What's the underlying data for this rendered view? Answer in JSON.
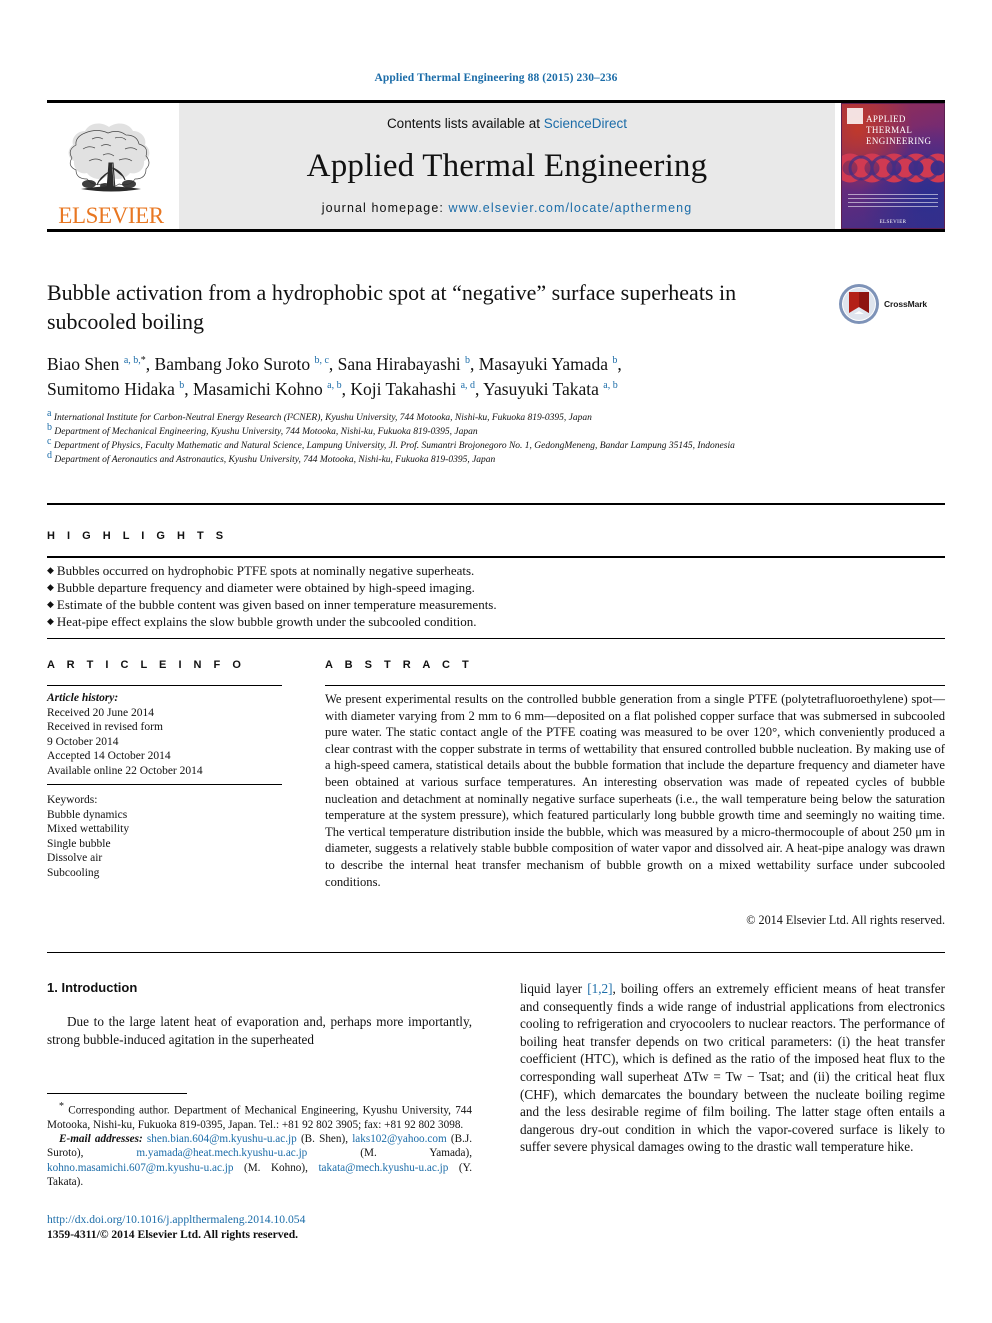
{
  "running_head": "Applied Thermal Engineering 88 (2015) 230–236",
  "masthead": {
    "contents_prefix": "Contents lists available at ",
    "sciencedirect": "ScienceDirect",
    "journal_title": "Applied Thermal Engineering",
    "homepage_prefix": "journal homepage: ",
    "homepage_url": "www.elsevier.com/locate/apthermeng",
    "publisher": "ELSEVIER",
    "cover": {
      "line1": "Applied",
      "line2": "Thermal",
      "line3": "Engineering",
      "footer": "ELSEVIER"
    },
    "colors": {
      "link": "#1b6ca8",
      "elsevier_orange": "#E87722",
      "masthead_bg": "#e9e9e9"
    }
  },
  "article": {
    "title": "Bubble activation from a hydrophobic spot at “negative” surface superheats in subcooled boiling",
    "crossmark_label": "CrossMark",
    "authors_line1": "Biao Shen a, b, *, Bambang Joko Suroto b, c, Sana Hirabayashi b, Masayuki Yamada b,",
    "authors_line2": "Sumitomo Hidaka b, Masamichi Kohno a, b, Koji Takahashi a, d, Yasuyuki Takata a, b",
    "affiliations": [
      "International Institute for Carbon-Neutral Energy Research (I²CNER), Kyushu University, 744 Motooka, Nishi-ku, Fukuoka 819-0395, Japan",
      "Department of Mechanical Engineering, Kyushu University, 744 Motooka, Nishi-ku, Fukuoka 819-0395, Japan",
      "Department of Physics, Faculty Mathematic and Natural Science, Lampung University, Jl. Prof. Sumantri Brojonegoro No. 1, GedongMeneng, Bandar Lampung 35145, Indonesia",
      "Department of Aeronautics and Astronautics, Kyushu University, 744 Motooka, Nishi-ku, Fukuoka 819-0395, Japan"
    ],
    "affiliation_marks": [
      "a",
      "b",
      "c",
      "d"
    ]
  },
  "highlights": {
    "heading": "H I G H L I G H T S",
    "items": [
      "Bubbles occurred on hydrophobic PTFE spots at nominally negative superheats.",
      "Bubble departure frequency and diameter were obtained by high-speed imaging.",
      "Estimate of the bubble content was given based on inner temperature measurements.",
      "Heat-pipe effect explains the slow bubble growth under the subcooled condition."
    ]
  },
  "article_info": {
    "heading": "A R T I C L E   I N F O",
    "history_label": "Article history:",
    "history": [
      "Received 20 June 2014",
      "Received in revised form",
      "9 October 2014",
      "Accepted 14 October 2014",
      "Available online 22 October 2014"
    ],
    "keywords_label": "Keywords:",
    "keywords": [
      "Bubble dynamics",
      "Mixed wettability",
      "Single bubble",
      "Dissolve air",
      "Subcooling"
    ]
  },
  "abstract": {
    "heading": "A B S T R A C T",
    "text": "We present experimental results on the controlled bubble generation from a single PTFE (polytetrafluoroethylene) spot—with diameter varying from 2 mm to 6 mm—deposited on a flat polished copper surface that was submersed in subcooled pure water. The static contact angle of the PTFE coating was measured to be over 120°, which conveniently produced a clear contrast with the copper substrate in terms of wettability that ensured controlled bubble nucleation. By making use of a high-speed camera, statistical details about the bubble formation that include the departure frequency and diameter have been obtained at various surface temperatures. An interesting observation was made of repeated cycles of bubble nucleation and detachment at nominally negative surface superheats (i.e., the wall temperature being below the saturation temperature at the system pressure), which featured particularly long bubble growth time and seemingly no waiting time. The vertical temperature distribution inside the bubble, which was measured by a micro-thermocouple of about 250 μm in diameter, suggests a relatively stable bubble composition of water vapor and dissolved air. A heat-pipe analogy was drawn to describe the internal heat transfer mechanism of bubble growth on a mixed wettability surface under subcooled conditions.",
    "copyright": "© 2014 Elsevier Ltd. All rights reserved."
  },
  "body": {
    "section_number_title": "1.  Introduction",
    "left_paragraph": "Due to the large latent heat of evaporation and, perhaps more importantly, strong bubble-induced agitation in the superheated",
    "right_paragraph_pre": "liquid layer ",
    "right_reference": "[1,2]",
    "right_paragraph_post": ", boiling offers an extremely efficient means of heat transfer and consequently finds a wide range of industrial applications from electronics cooling to refrigeration and cryocoolers to nuclear reactors. The performance of boiling heat transfer depends on two critical parameters: (i) the heat transfer coefficient (HTC), which is defined as the ratio of the imposed heat flux to the corresponding wall superheat ΔTw = Tw − Tsat; and (ii) the critical heat flux (CHF), which demarcates the boundary between the nucleate boiling regime and the less desirable regime of film boiling. The latter stage often entails a dangerous dry-out condition in which the vapor-covered surface is likely to suffer severe physical damages owing to the drastic wall temperature hike."
  },
  "footnotes": {
    "corresponding": "Corresponding author. Department of Mechanical Engineering, Kyushu University, 744 Motooka, Nishi-ku, Fukuoka 819-0395, Japan. Tel.: +81 92 802 3905; fax: +81 92 802 3098.",
    "email_label": "E-mail addresses:",
    "emails": [
      {
        "address": "shen.bian.604@m.kyushu-u.ac.jp",
        "name": "(B. Shen)"
      },
      {
        "address": "laks102@yahoo.com",
        "name": "(B.J. Suroto)"
      },
      {
        "address": "m.yamada@heat.mech.kyushu-u.ac.jp",
        "name": "(M. Yamada)"
      },
      {
        "address": "kohno.masamichi.607@m.kyushu-u.ac.jp",
        "name": "(M. Kohno)"
      },
      {
        "address": "takata@mech.kyushu-u.ac.jp",
        "name": "(Y. Takata)"
      }
    ]
  },
  "doi": {
    "url": "http://dx.doi.org/10.1016/j.applthermaleng.2014.10.054",
    "issn_line": "1359-4311/© 2014 Elsevier Ltd. All rights reserved."
  }
}
